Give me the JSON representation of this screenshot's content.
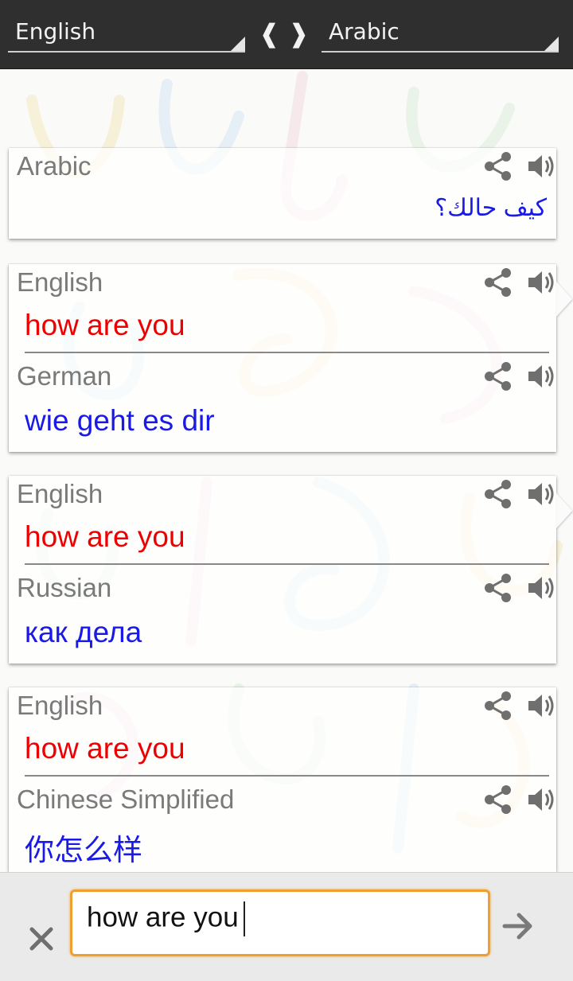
{
  "topbar": {
    "source_language": "English",
    "target_language": "Arabic",
    "swap_glyph": "❰❱",
    "source_dropdown_icon": "dropdown-triangle-icon",
    "target_dropdown_icon": "dropdown-triangle-icon",
    "swap_icon": "swap-languages-icon"
  },
  "result_card": {
    "language": "Arabic",
    "text": "كيف حالك؟",
    "share_icon": "share-icon",
    "speaker_icon": "speaker-icon"
  },
  "history": [
    {
      "source_language": "English",
      "source_text": "how are you",
      "target_language": "German",
      "target_text": "wie geht es dir"
    },
    {
      "source_language": "English",
      "source_text": "how are you",
      "target_language": "Russian",
      "target_text": "как дела"
    },
    {
      "source_language": "English",
      "source_text": "how are you",
      "target_language": "Chinese Simplified",
      "target_text": "你怎么样"
    }
  ],
  "input_bar": {
    "value": "how are you",
    "clear_icon": "close-icon",
    "submit_icon": "arrow-right-icon"
  },
  "colors": {
    "topbar": "#2f2f2f",
    "source_text": "#ee0000",
    "target_text": "#1a1ae6",
    "input_border": "#f0a030"
  }
}
